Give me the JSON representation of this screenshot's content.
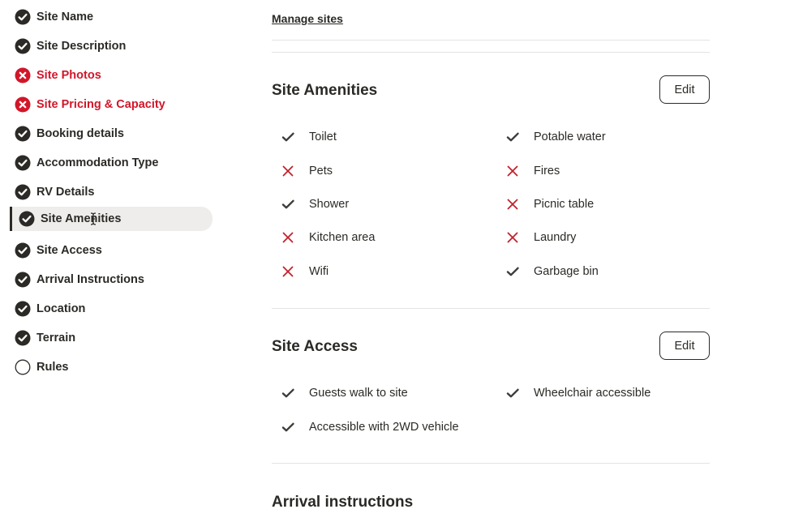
{
  "sidebar": {
    "items": [
      {
        "label": "Site Name",
        "status": "done"
      },
      {
        "label": "Site Description",
        "status": "done"
      },
      {
        "label": "Site Photos",
        "status": "error"
      },
      {
        "label": "Site Pricing & Capacity",
        "status": "error"
      },
      {
        "label": "Booking details",
        "status": "done"
      },
      {
        "label": "Accommodation Type",
        "status": "done"
      },
      {
        "label": "RV Details",
        "status": "done"
      },
      {
        "label": "Site Amenities",
        "status": "done",
        "active": true
      },
      {
        "label": "Site Access",
        "status": "done"
      },
      {
        "label": "Arrival Instructions",
        "status": "done"
      },
      {
        "label": "Location",
        "status": "done"
      },
      {
        "label": "Terrain",
        "status": "done"
      },
      {
        "label": "Rules",
        "status": "empty"
      }
    ]
  },
  "main": {
    "manage_sites": "Manage sites",
    "amenities": {
      "title": "Site Amenities",
      "edit_label": "Edit",
      "items": [
        {
          "label": "Toilet",
          "available": true
        },
        {
          "label": "Potable water",
          "available": true
        },
        {
          "label": "Pets",
          "available": false
        },
        {
          "label": "Fires",
          "available": false
        },
        {
          "label": "Shower",
          "available": true
        },
        {
          "label": "Picnic table",
          "available": false
        },
        {
          "label": "Kitchen area",
          "available": false
        },
        {
          "label": "Laundry",
          "available": false
        },
        {
          "label": "Wifi",
          "available": false
        },
        {
          "label": "Garbage bin",
          "available": true
        }
      ]
    },
    "access": {
      "title": "Site Access",
      "edit_label": "Edit",
      "items": [
        {
          "label": "Guests walk to site",
          "available": true
        },
        {
          "label": "Wheelchair accessible",
          "available": true
        },
        {
          "label": "Accessible with 2WD vehicle",
          "available": true
        }
      ]
    },
    "arrival": {
      "title": "Arrival instructions"
    }
  },
  "colors": {
    "text": "#2b2a26",
    "error": "#d2162a",
    "active_bg": "#efedeb",
    "divider": "#e6e4e1"
  }
}
